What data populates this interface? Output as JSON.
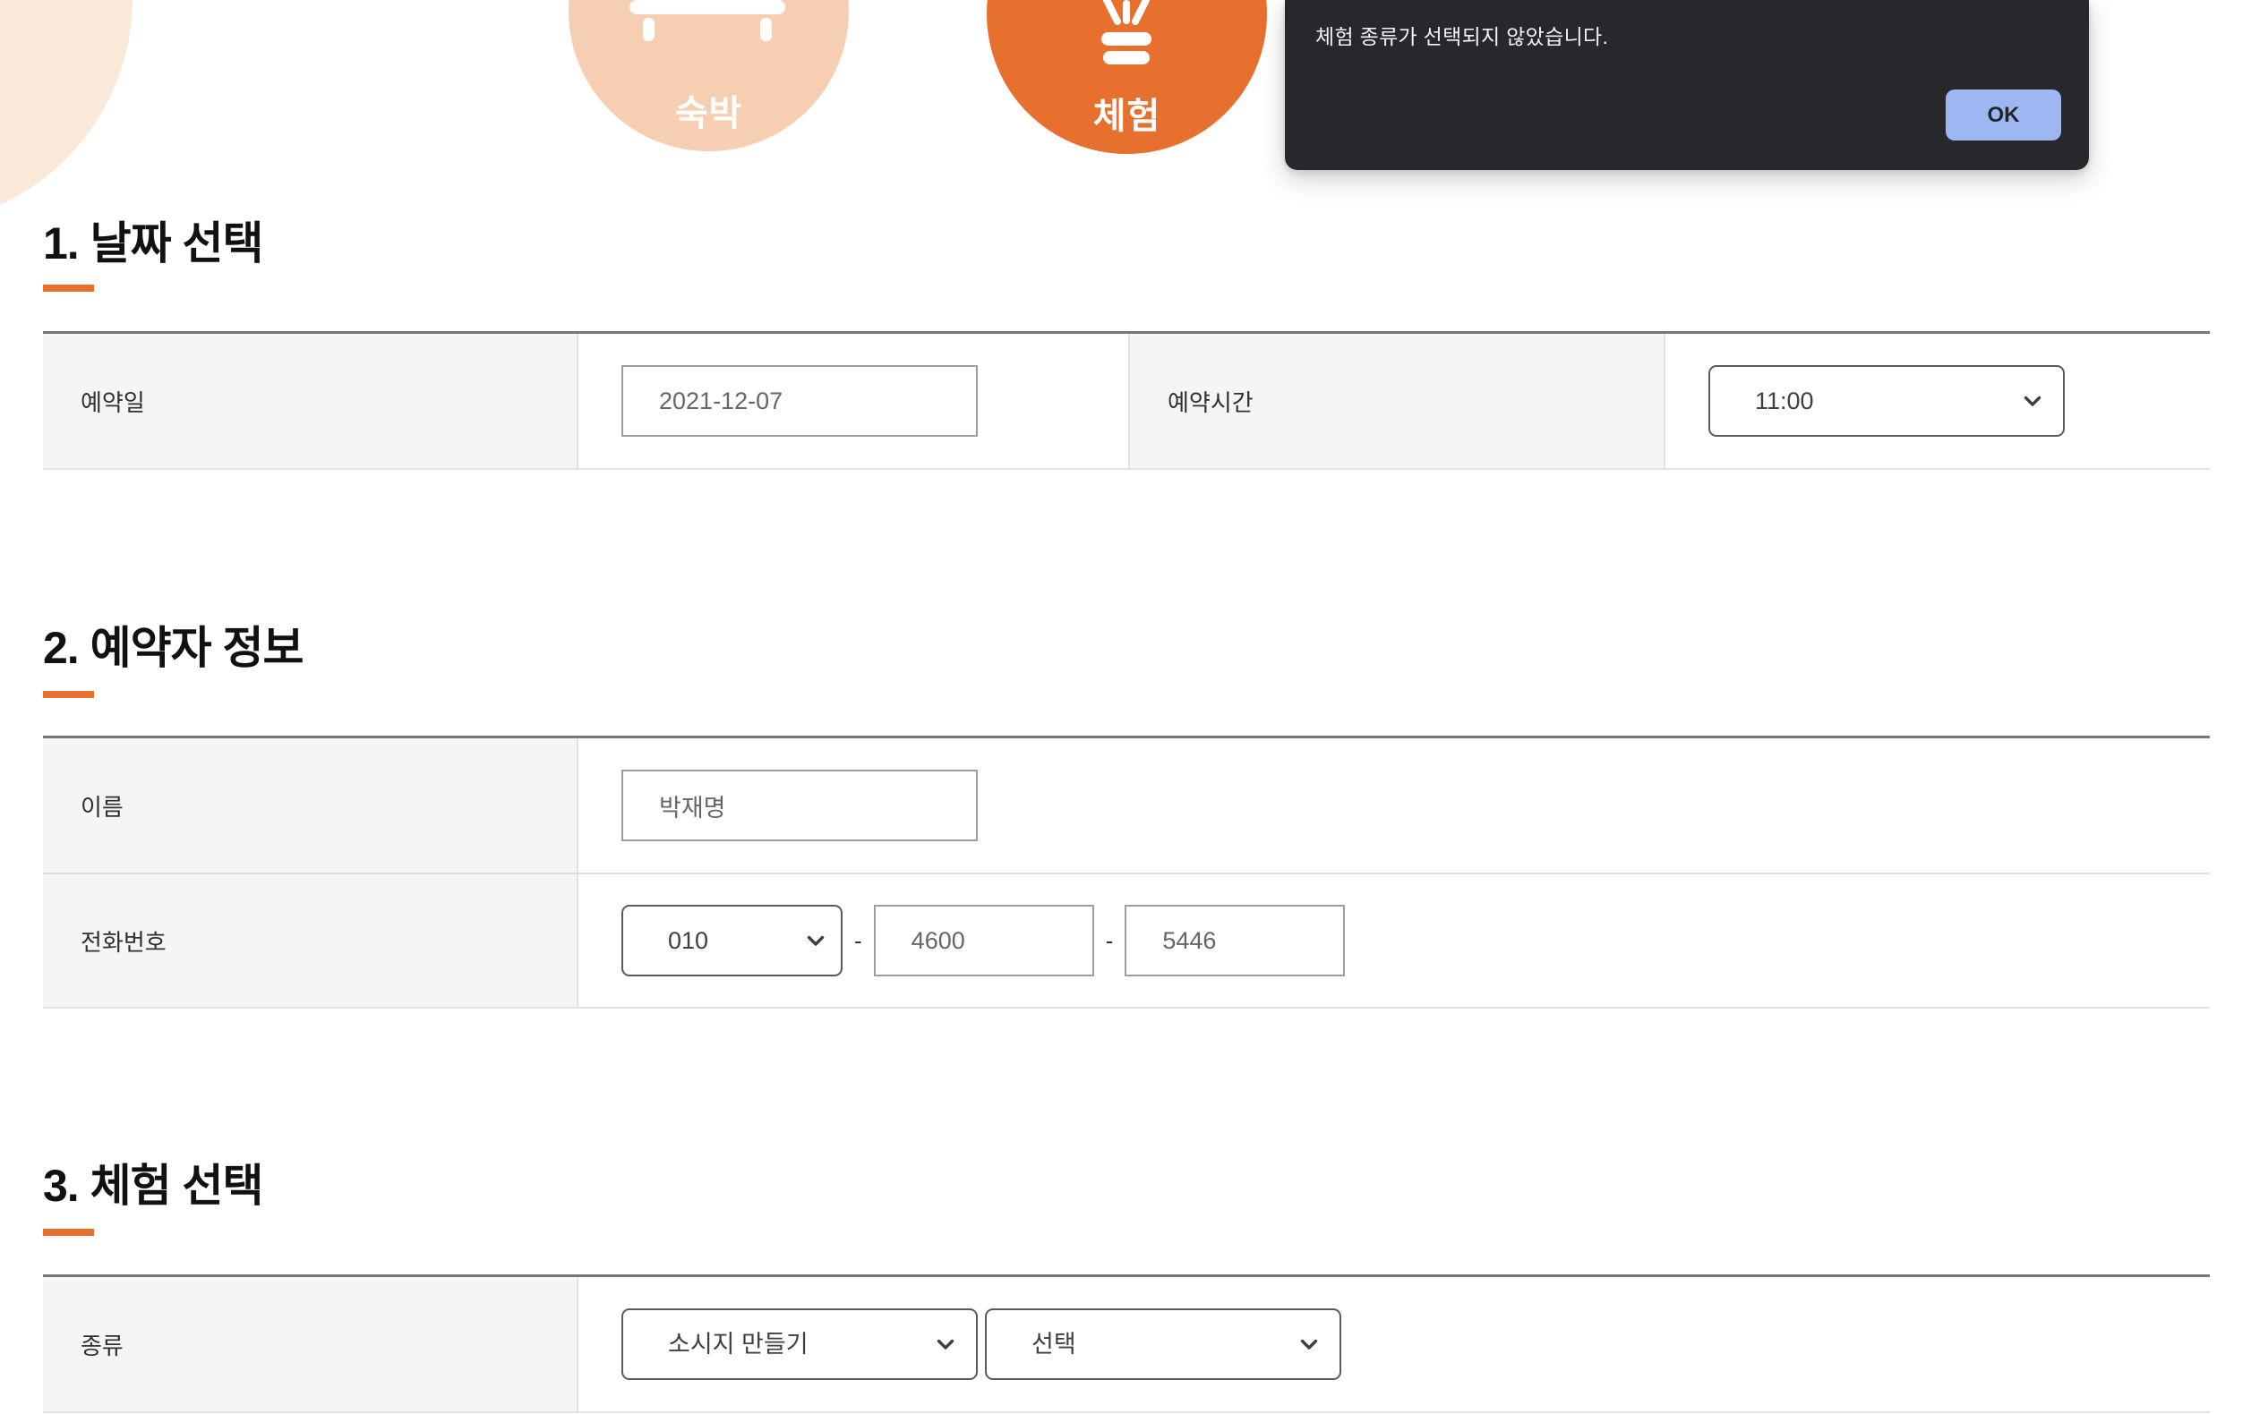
{
  "theme": {
    "accent": "#e8702e",
    "lodging_circle": "#f6ceb2",
    "ring": "#fae8d8",
    "dialog_bg": "#27282c",
    "ok_button_bg": "#9db7f2"
  },
  "categories": {
    "lodging_label": "숙박",
    "experience_label": "체험"
  },
  "dialog": {
    "message": "체험 종류가 선택되지 않았습니다.",
    "ok_label": "OK"
  },
  "section1": {
    "title": "1. 날짜 선택",
    "date_label": "예약일",
    "date_value": "2021-12-07",
    "time_label": "예약시간",
    "time_value": "11:00"
  },
  "section2": {
    "title": "2. 예약자 정보",
    "name_label": "이름",
    "name_value": "박재명",
    "phone_label": "전화번호",
    "phone_prefix": "010",
    "phone_mid": "4600",
    "phone_last": "5446",
    "phone_separator": "-"
  },
  "section3": {
    "title": "3. 체험 선택",
    "kind_label": "종류",
    "kind_value": "소시지 만들기",
    "option_value": "선택"
  }
}
